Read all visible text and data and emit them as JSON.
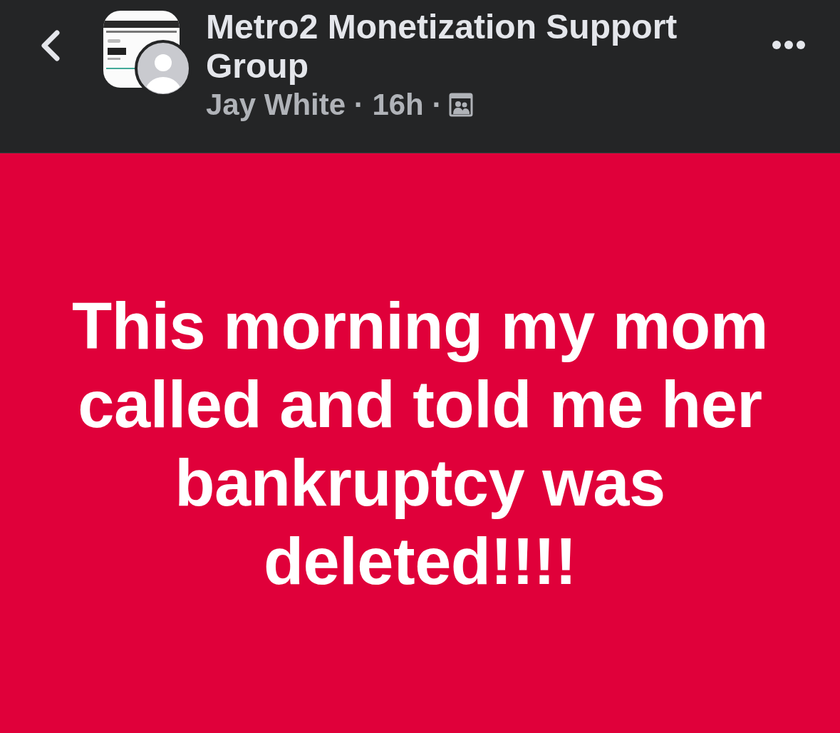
{
  "header": {
    "title": "Metro2 Monetization Support Group",
    "byline": "Jay White · 16h ·"
  },
  "post": {
    "text": "This morning my mom called and told me her bankruptcy was deleted!!!!"
  }
}
